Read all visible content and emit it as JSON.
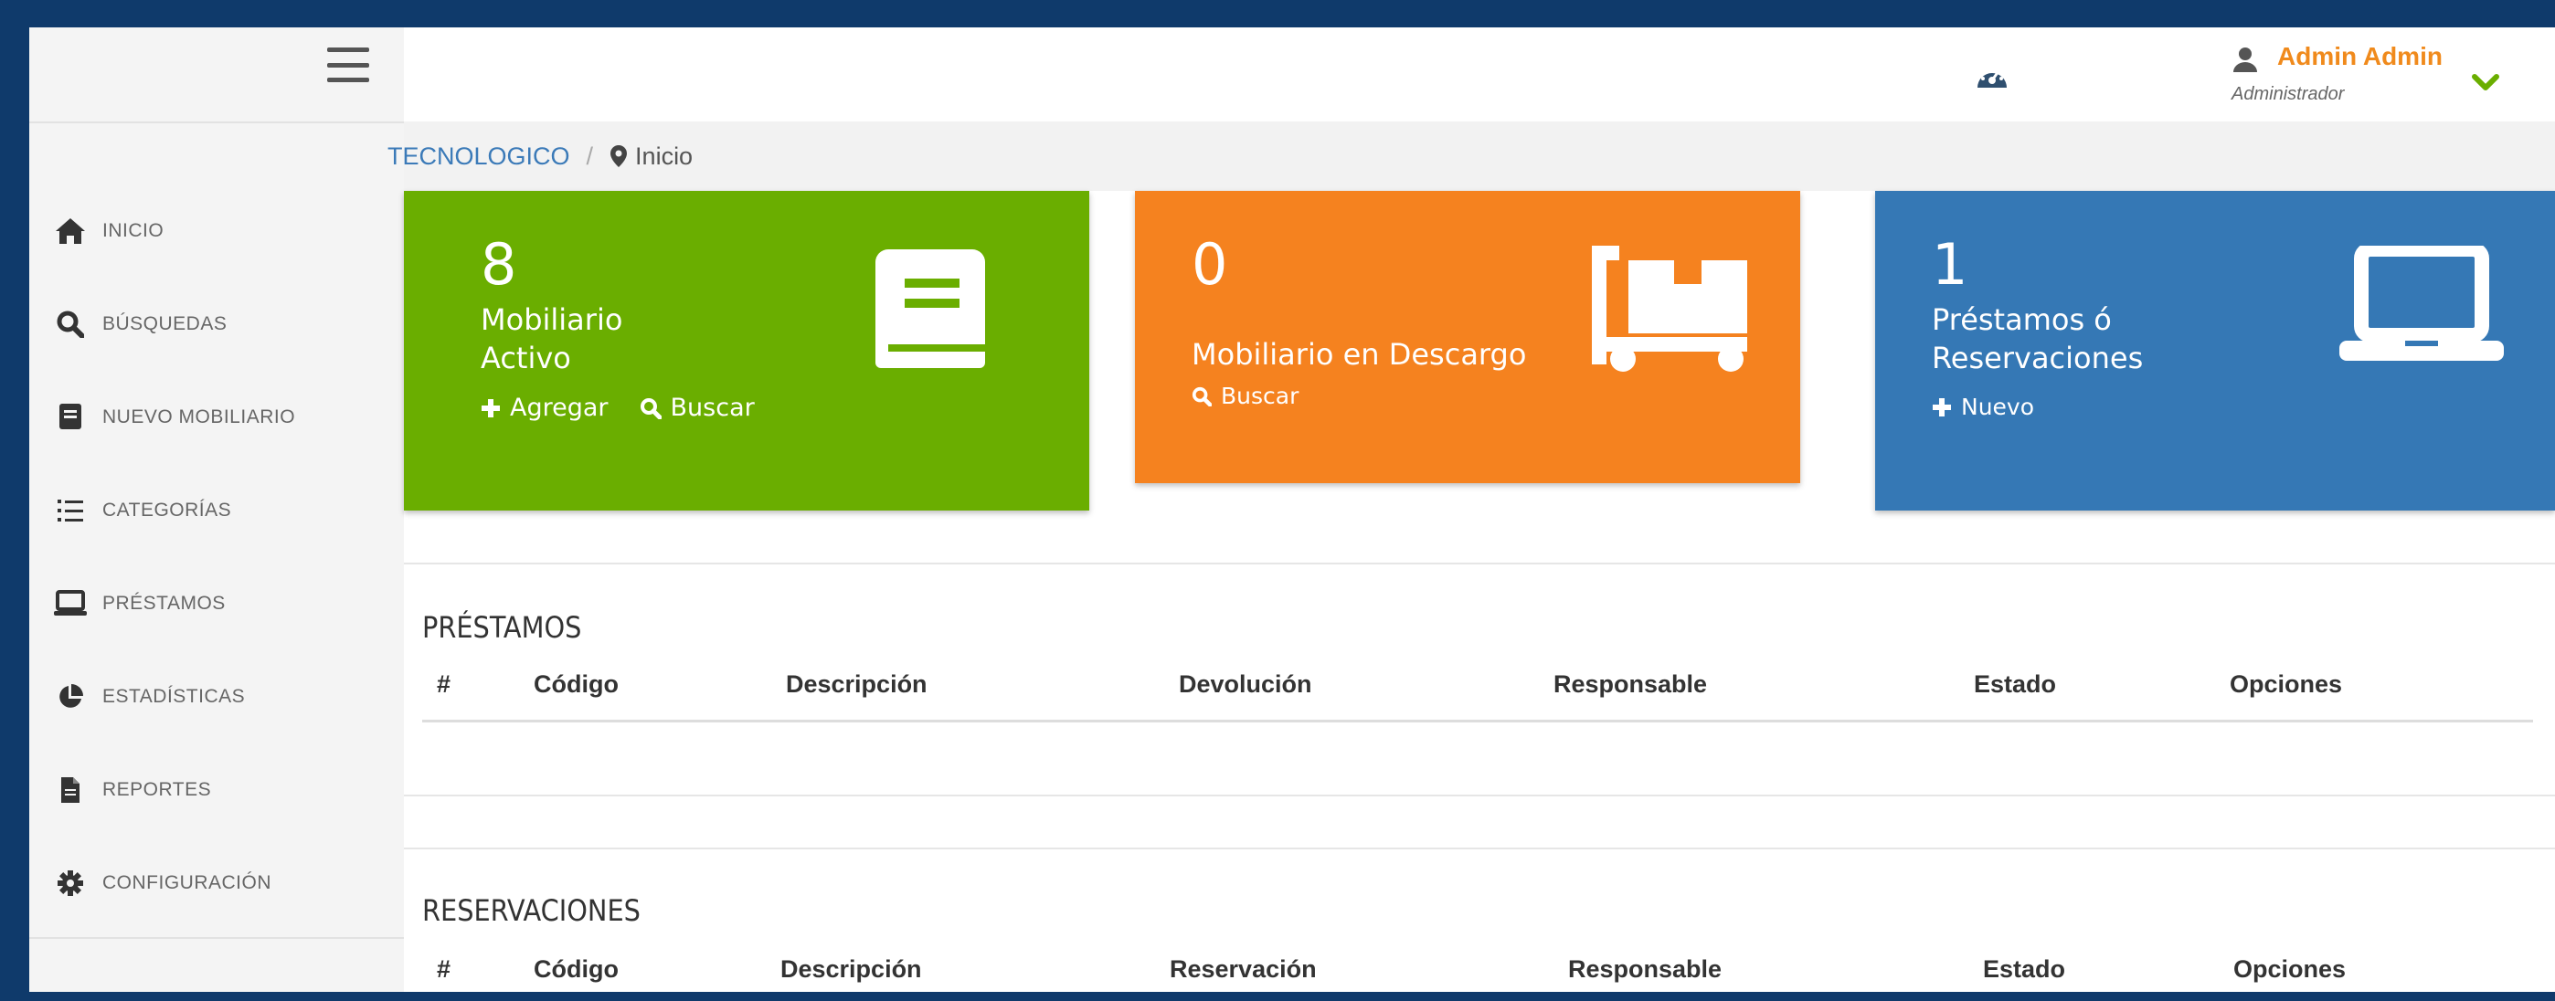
{
  "sidebar": {
    "items": [
      {
        "label": "INICIO",
        "icon": "home-icon"
      },
      {
        "label": "BÚSQUEDAS",
        "icon": "search-icon"
      },
      {
        "label": "NUEVO MOBILIARIO",
        "icon": "book-icon"
      },
      {
        "label": "CATEGORÍAS",
        "icon": "list-icon"
      },
      {
        "label": "PRÉSTAMOS",
        "icon": "laptop-icon"
      },
      {
        "label": "ESTADÍSTICAS",
        "icon": "pie-chart-icon"
      },
      {
        "label": "REPORTES",
        "icon": "file-icon"
      },
      {
        "label": "CONFIGURACIÓN",
        "icon": "gear-icon"
      }
    ]
  },
  "header": {
    "user_name": "Admin Admin",
    "user_role": "Administrador"
  },
  "breadcrumb": {
    "root": "TECNOLOGICO",
    "separator": "/",
    "current": "Inicio"
  },
  "cards": {
    "active": {
      "count": "8",
      "title": "Mobiliario\nActivo",
      "add_label": "Agregar",
      "search_label": "Buscar",
      "color": "#6aae00"
    },
    "discharge": {
      "count": "0",
      "title": "Mobiliario en Descargo",
      "search_label": "Buscar",
      "color": "#f5821f"
    },
    "loans": {
      "count": "1",
      "title": "Préstamos ó\nReservaciones",
      "new_label": "Nuevo",
      "color": "#3578b5"
    }
  },
  "loans_table": {
    "title": "PRÉSTAMOS",
    "columns": [
      "#",
      "Código",
      "Descripción",
      "Devolución",
      "Responsable",
      "Estado",
      "Opciones"
    ]
  },
  "reservations_table": {
    "title": "RESERVACIONES",
    "columns": [
      "#",
      "Código",
      "Descripción",
      "Reservación",
      "Responsable",
      "Estado",
      "Opciones"
    ]
  },
  "colors": {
    "accent_orange": "#f08a1c",
    "link_blue": "#3b7ab8",
    "chevron_green": "#6aae00"
  }
}
